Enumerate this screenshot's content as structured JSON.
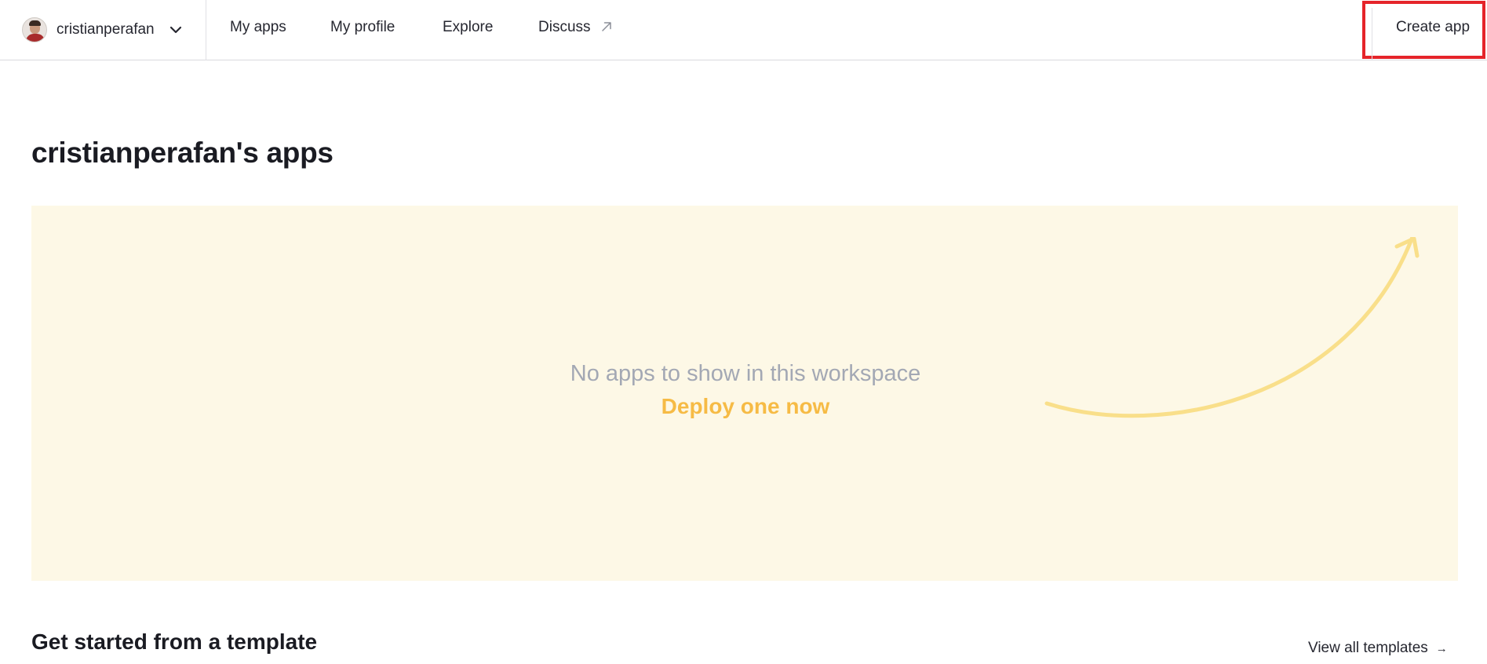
{
  "header": {
    "workspace": {
      "name": "cristianperafan",
      "avatar_icon": "user-avatar",
      "dropdown_icon": "chevron-down-icon"
    },
    "nav": [
      {
        "label": "My apps"
      },
      {
        "label": "My profile"
      },
      {
        "label": "Explore"
      },
      {
        "label": "Discuss",
        "icon": "external-link-icon"
      }
    ],
    "create_app_label": "Create app"
  },
  "main": {
    "title": "cristianperafan's apps",
    "empty_state": {
      "message": "No apps to show in this workspace",
      "cta": "Deploy one now",
      "arrow_icon": "curved-arrow-icon"
    },
    "templates": {
      "title": "Get started from a template",
      "view_all_label": "View all templates",
      "view_all_icon": "arrow-right-icon"
    }
  },
  "colors": {
    "highlight_border": "#e5242a",
    "empty_panel_bg": "#fdf8e6",
    "cta_text": "#f6bb45",
    "arrow_stroke": "#f9df8a",
    "muted_text": "#a3a8b4"
  }
}
